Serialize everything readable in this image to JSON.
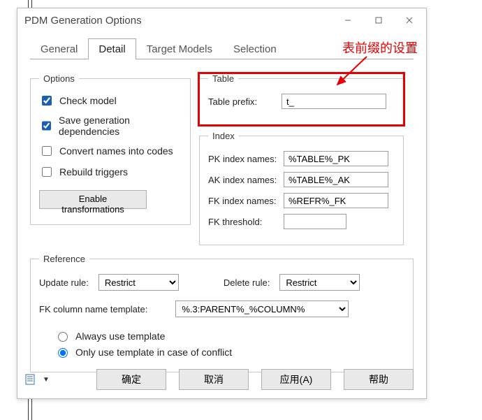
{
  "window": {
    "title": "PDM Generation Options"
  },
  "tabs": {
    "general": "General",
    "detail": "Detail",
    "target": "Target Models",
    "selection": "Selection"
  },
  "options": {
    "legend": "Options",
    "check_model": "Check model",
    "save_deps": "Save generation dependencies",
    "convert_names": "Convert names into codes",
    "rebuild_triggers": "Rebuild triggers",
    "enable_transformations": "Enable transformations"
  },
  "table": {
    "legend": "Table",
    "prefix_label": "Table prefix:",
    "prefix_value": "t_"
  },
  "index": {
    "legend": "Index",
    "pk_label": "PK index names:",
    "pk_value": "%TABLE%_PK",
    "ak_label": "AK index names:",
    "ak_value": "%TABLE%_AK",
    "fk_label": "FK index names:",
    "fk_value": "%REFR%_FK",
    "thresh_label": "FK threshold:",
    "thresh_value": ""
  },
  "reference": {
    "legend": "Reference",
    "update_label": "Update rule:",
    "update_value": "Restrict",
    "delete_label": "Delete rule:",
    "delete_value": "Restrict",
    "fkcol_label": "FK column name template:",
    "fkcol_value": "%.3:PARENT%_%COLUMN%",
    "radio_always": "Always use template",
    "radio_conflict": "Only use template in case of conflict"
  },
  "buttons": {
    "ok": "确定",
    "cancel": "取消",
    "apply": "应用(A)",
    "help": "帮助"
  },
  "annotation": "表前缀的设置"
}
